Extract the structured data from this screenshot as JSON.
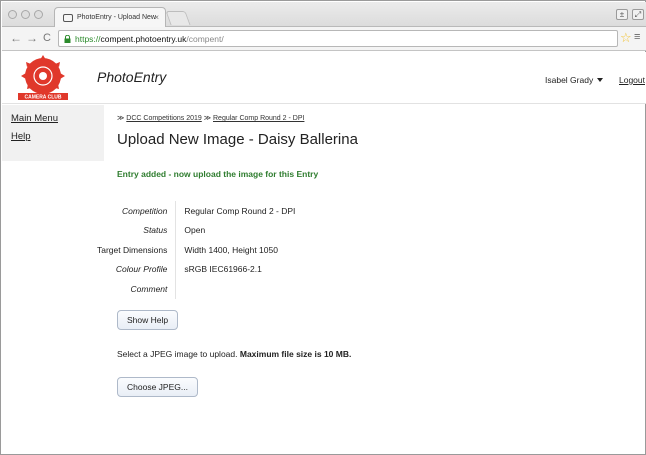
{
  "browser": {
    "tab_title": "PhotoEntry - Upload New",
    "tab_close": "×",
    "url_scheme": "https://",
    "url_host": "compent.photoentry.uk",
    "url_path": "/compent/",
    "back": "←",
    "forward": "→",
    "reload": "C",
    "star": "☆",
    "menu": "≡",
    "window_left_btn": "±",
    "window_right_btn": "⤢"
  },
  "header": {
    "app_title": "PhotoEntry",
    "user_name": "Isabel Grady",
    "logout_label": "Logout",
    "logo_text": "CAMERA CLUB"
  },
  "sidebar": {
    "items": [
      {
        "label": "Main Menu"
      },
      {
        "label": "Help"
      }
    ]
  },
  "breadcrumb": {
    "sep": "≫",
    "items": [
      {
        "label": "DCC Competitions 2019"
      },
      {
        "label": "Regular Comp Round 2 - DPI"
      }
    ]
  },
  "main": {
    "page_title": "Upload New Image - Daisy Ballerina",
    "flash_message": "Entry added - now upload the image for this Entry",
    "details": [
      {
        "label": "Competition",
        "value": "Regular Comp Round 2 - DPI"
      },
      {
        "label": "Status",
        "value": "Open"
      },
      {
        "label": "Target Dimensions",
        "value": "Width 1400, Height 1050"
      },
      {
        "label": "Colour Profile",
        "value": "sRGB IEC61966-2.1"
      },
      {
        "label": "Comment",
        "value": ""
      }
    ],
    "show_help_label": "Show Help",
    "select_text": "Select a JPEG image to upload. ",
    "select_text_bold": "Maximum file size is 10 MB.",
    "choose_label": "Choose JPEG..."
  },
  "colors": {
    "accent_green": "#2f7d2f",
    "logo_red": "#e0382b"
  }
}
